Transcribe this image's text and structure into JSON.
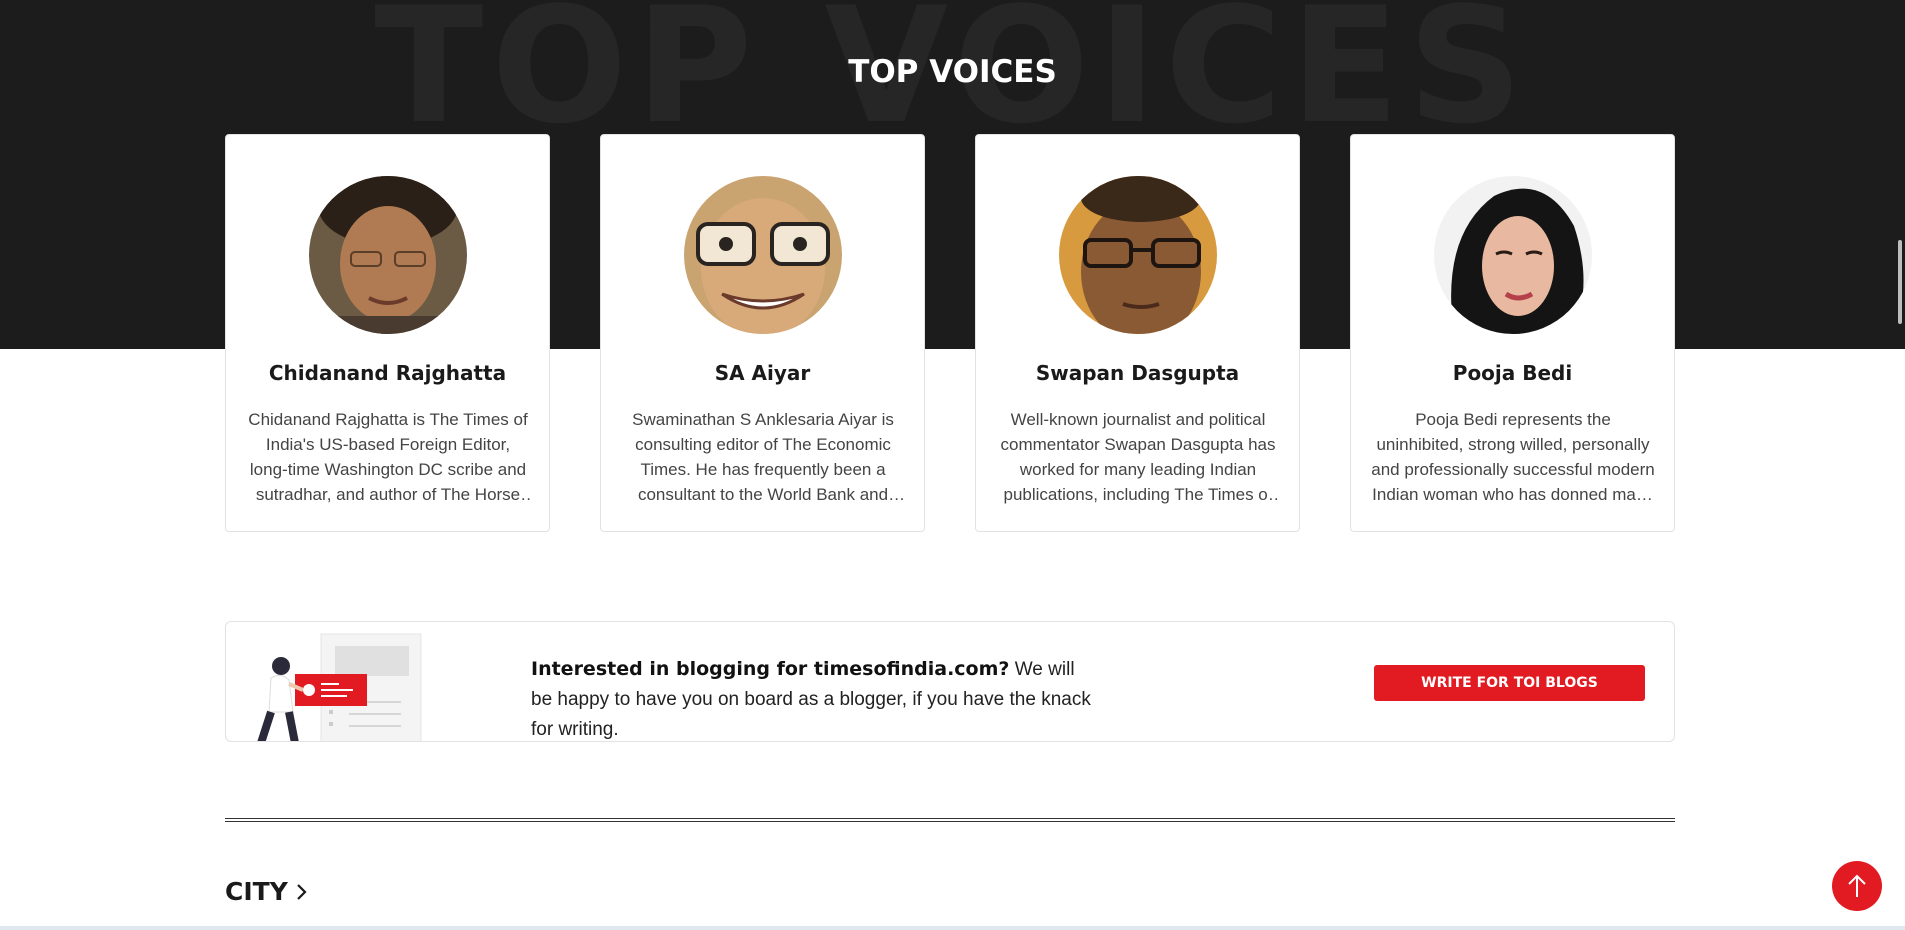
{
  "hero": {
    "watermark": "TOP VOICES",
    "title": "TOP VOICES"
  },
  "voices": [
    {
      "name": "Chidanand Rajghatta",
      "bio": "Chidanand Rajghatta is The Times of India's US-based Foreign Editor, long-time Washington DC scribe and sutradhar, and author of The Horse That Flew",
      "avatar_icon": "portrait-chidanand-rajghatta"
    },
    {
      "name": "SA Aiyar",
      "bio": "Swaminathan S Anklesaria Aiyar is consulting editor of The Economic Times. He has frequently been a consultant to the World Bank and IMF",
      "avatar_icon": "portrait-sa-aiyar"
    },
    {
      "name": "Swapan Dasgupta",
      "bio": "Well-known journalist and political commentator Swapan Dasgupta has worked for many leading Indian publications, including The Times of India",
      "avatar_icon": "portrait-swapan-dasgupta"
    },
    {
      "name": "Pooja Bedi",
      "bio": "Pooja Bedi represents the uninhibited, strong willed, personally and professionally successful modern Indian woman who has donned many hats",
      "avatar_icon": "portrait-pooja-bedi"
    }
  ],
  "blog_banner": {
    "headline": "Interested in blogging for timesofindia.com?",
    "text": " We will be happy to have you on board as a blogger, if you have the knack for writing.",
    "button_label": "WRITE FOR TOI BLOGS",
    "illustration_icon": "blogger-illustration"
  },
  "section": {
    "city_label": "CITY",
    "chevron_icon": "chevron-right-icon"
  },
  "scroll_top_icon": "arrow-up-icon",
  "colors": {
    "hero_bg": "#1c1c1c",
    "accent_red": "#e21b22",
    "card_border": "#e2e2e2"
  }
}
